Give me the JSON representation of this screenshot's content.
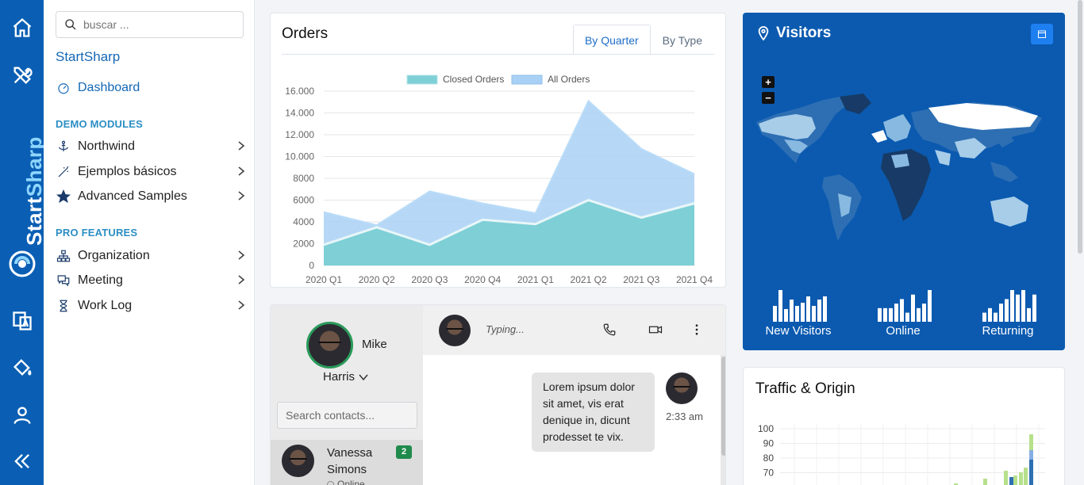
{
  "colors": {
    "rail": "#0a5fb4",
    "accent": "#1467b6",
    "section": "#2c8ec4",
    "closed_fill": "#7ecfd6",
    "all_fill": "#a9d1f5",
    "visitors_bg": "#0b5ab0"
  },
  "rail": {
    "brand_a": "Start",
    "brand_b": "Sharp",
    "icons": [
      "home-icon",
      "tools-icon",
      "brand-logo",
      "translate-icon",
      "paint-bucket-icon",
      "user-icon",
      "collapse-icon"
    ]
  },
  "sidebar": {
    "search_placeholder": "buscar ...",
    "app_name": "StartSharp",
    "dashboard": "Dashboard",
    "demo_header": "DEMO MODULES",
    "demo_items": [
      "Northwind",
      "Ejemplos básicos",
      "Advanced Samples"
    ],
    "pro_header": "PRO FEATURES",
    "pro_items": [
      "Organization",
      "Meeting",
      "Work Log"
    ]
  },
  "orders": {
    "title": "Orders",
    "tabs": [
      "By Quarter",
      "By Type"
    ],
    "active_tab": "By Quarter"
  },
  "chart_data": {
    "type": "area",
    "categories": [
      "2020 Q1",
      "2020 Q2",
      "2020 Q3",
      "2020 Q4",
      "2021 Q1",
      "2021 Q2",
      "2021 Q3",
      "2021 Q4"
    ],
    "series": [
      {
        "name": "Closed Orders",
        "values": [
          1900,
          3500,
          1900,
          4200,
          3800,
          6000,
          4400,
          5700
        ]
      },
      {
        "name": "All Orders",
        "values": [
          4900,
          3700,
          6800,
          5700,
          4800,
          15100,
          10700,
          8400
        ]
      }
    ],
    "ylim": [
      0,
      16000
    ],
    "yticks": [
      "0",
      "2000",
      "4000",
      "6000",
      "8000",
      "10.000",
      "12.000",
      "14.000",
      "16.000"
    ],
    "grid": true,
    "legend": "top"
  },
  "visitors": {
    "title": "Visitors",
    "zoom_in": "+",
    "zoom_out": "−",
    "sparks": [
      {
        "label": "New Visitors",
        "values": [
          5,
          10,
          4,
          7,
          5,
          6,
          8,
          5,
          7,
          8
        ]
      },
      {
        "label": "Online",
        "values": [
          3,
          3,
          3,
          4,
          5,
          2,
          6,
          3,
          4,
          7
        ]
      },
      {
        "label": "Returning",
        "values": [
          2,
          3,
          2,
          4,
          5,
          7,
          6,
          7,
          3,
          6
        ]
      }
    ]
  },
  "chat": {
    "user_first": "Mike",
    "user_last": "Harris",
    "contact_search_placeholder": "Search contacts...",
    "contact_first": "Vanessa",
    "contact_last": "Simons",
    "contact_status": "Online",
    "contact_badge": "2",
    "typing": "Typing...",
    "message": "Lorem ipsum dolor sit amet, vis erat denique in, dicunt prodesset te vix.",
    "message_time": "2:33 am"
  },
  "traffic": {
    "title": "Traffic & Origin",
    "yticks": [
      "100",
      "90",
      "80",
      "70"
    ]
  }
}
